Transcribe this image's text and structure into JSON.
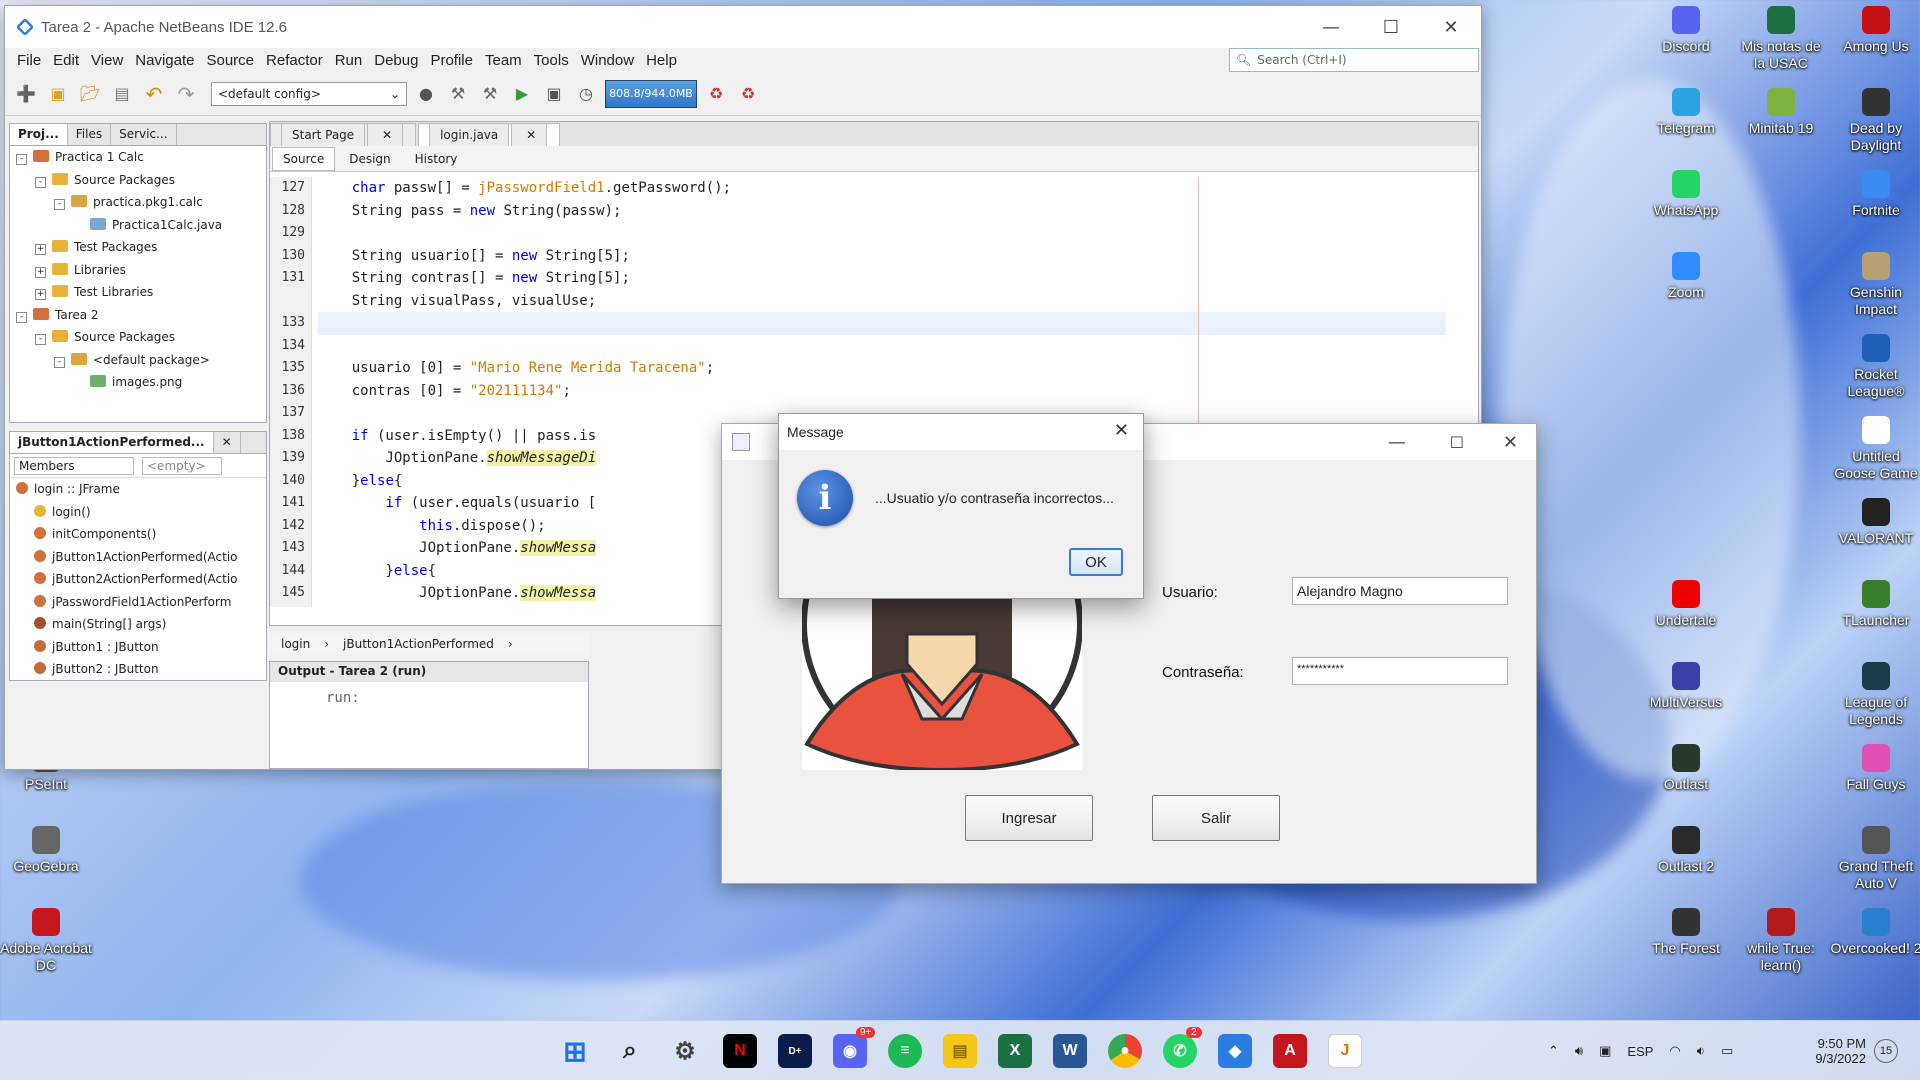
{
  "netbeans": {
    "title": "Tarea 2 - Apache NetBeans IDE 12.6",
    "menu": [
      "File",
      "Edit",
      "View",
      "Navigate",
      "Source",
      "Refactor",
      "Run",
      "Debug",
      "Profile",
      "Team",
      "Tools",
      "Window",
      "Help"
    ],
    "search_placeholder": "Search (Ctrl+I)",
    "config": "<default config>",
    "memory": "808.8/944.0MB",
    "projects_tabs": [
      "Proj...",
      "Files",
      "Servic..."
    ],
    "tree": [
      {
        "label": "Practica 1 Calc",
        "depth": 0,
        "fold": "-",
        "icon": "project"
      },
      {
        "label": "Source Packages",
        "depth": 1,
        "fold": "-",
        "icon": "folder"
      },
      {
        "label": "practica.pkg1.calc",
        "depth": 2,
        "fold": "-",
        "icon": "package"
      },
      {
        "label": "Practica1Calc.java",
        "depth": 3,
        "fold": "",
        "icon": "java"
      },
      {
        "label": "Test Packages",
        "depth": 1,
        "fold": "+",
        "icon": "folder"
      },
      {
        "label": "Libraries",
        "depth": 1,
        "fold": "+",
        "icon": "folder"
      },
      {
        "label": "Test Libraries",
        "depth": 1,
        "fold": "+",
        "icon": "folder"
      },
      {
        "label": "Tarea 2",
        "depth": 0,
        "fold": "-",
        "icon": "project"
      },
      {
        "label": "Source Packages",
        "depth": 1,
        "fold": "-",
        "icon": "folder"
      },
      {
        "label": "<default package>",
        "depth": 2,
        "fold": "-",
        "icon": "package"
      },
      {
        "label": "images.png",
        "depth": 3,
        "fold": "",
        "icon": "image"
      }
    ],
    "navigator": {
      "title": "jButton1ActionPerformed...",
      "members_label": "Members",
      "filter": "<empty>",
      "items": [
        {
          "label": "login :: JFrame",
          "icon": "class"
        },
        {
          "label": "login()",
          "icon": "ctor"
        },
        {
          "label": "initComponents()",
          "icon": "method"
        },
        {
          "label": "jButton1ActionPerformed(Actio",
          "icon": "method"
        },
        {
          "label": "jButton2ActionPerformed(Actio",
          "icon": "method"
        },
        {
          "label": "jPasswordField1ActionPerform",
          "icon": "method"
        },
        {
          "label": "main(String[] args)",
          "icon": "static"
        },
        {
          "label": "jButton1 : JButton",
          "icon": "field"
        },
        {
          "label": "jButton2 : JButton",
          "icon": "field"
        }
      ]
    },
    "editor_tabs": [
      "Start Page",
      "login.java"
    ],
    "editor_modes": [
      "Source",
      "Design",
      "History"
    ],
    "line_numbers": [
      "127",
      "128",
      "129",
      "130",
      "131",
      "",
      "133",
      "134",
      "135",
      "136",
      "137",
      "138",
      "139",
      "140",
      "141",
      "142",
      "143",
      "144",
      "145"
    ],
    "breadcrumb": [
      "login",
      "jButton1ActionPerformed"
    ],
    "output_title": "Output - Tarea 2 (run)",
    "output_text": "run:"
  },
  "login_window": {
    "usuario_label": "Usuario:",
    "usuario_value": "Alejandro Magno",
    "contrasena_label": "Contraseña:",
    "contrasena_value": "***********",
    "ingresar": "Ingresar",
    "salir": "Salir"
  },
  "message_dialog": {
    "title": "Message",
    "text": "...Usuatio y/o contraseña incorrectos...",
    "ok": "OK"
  },
  "desktop_icons": [
    {
      "label": "Discord",
      "color": "#5865f2"
    },
    {
      "label": "Mis notas de la USAC",
      "color": "#1d7044"
    },
    {
      "label": "Among Us",
      "color": "#c51111"
    },
    {
      "label": "Telegram",
      "color": "#2aa3e0"
    },
    {
      "label": "Minitab 19",
      "color": "#7cb342"
    },
    {
      "label": "Dead by Daylight",
      "color": "#333"
    },
    {
      "label": "WhatsApp",
      "color": "#25d366"
    },
    {
      "label": "Fortnite",
      "color": "#3a8df0"
    },
    {
      "label": "Zoom",
      "color": "#2d8cff"
    },
    {
      "label": "Genshin Impact",
      "color": "#b7a074"
    },
    {
      "label": "Rocket League®",
      "color": "#1e5fb8"
    },
    {
      "label": "Untitled Goose Game",
      "color": "#fff"
    },
    {
      "label": "VALORANT",
      "color": "#222"
    },
    {
      "label": "Undertale",
      "color": "#e00"
    },
    {
      "label": "TLauncher",
      "color": "#3a7d2a"
    },
    {
      "label": "MultiVersus",
      "color": "#3b3fa8"
    },
    {
      "label": "League of Legends",
      "color": "#1c3c4c"
    },
    {
      "label": "Outlast",
      "color": "#2a3a2a"
    },
    {
      "label": "Fall Guys",
      "color": "#e24fb3"
    },
    {
      "label": "Outlast 2",
      "color": "#2a2a2a"
    },
    {
      "label": "Grand Theft Auto V",
      "color": "#555"
    },
    {
      "label": "The Forest",
      "color": "#333"
    },
    {
      "label": "while True: learn()",
      "color": "#b31b1b"
    },
    {
      "label": "Overcooked! 2",
      "color": "#2a7fd0"
    },
    {
      "label": "PSeInt",
      "color": "#555"
    },
    {
      "label": "GeoGebra",
      "color": "#666"
    },
    {
      "label": "Adobe Acrobat DC",
      "color": "#c4161c"
    }
  ],
  "taskbar": {
    "badge_discord": "9+",
    "badge_whatsapp": "2",
    "language": "ESP",
    "time": "9:50 PM",
    "date": "9/3/2022",
    "notif": "15"
  }
}
